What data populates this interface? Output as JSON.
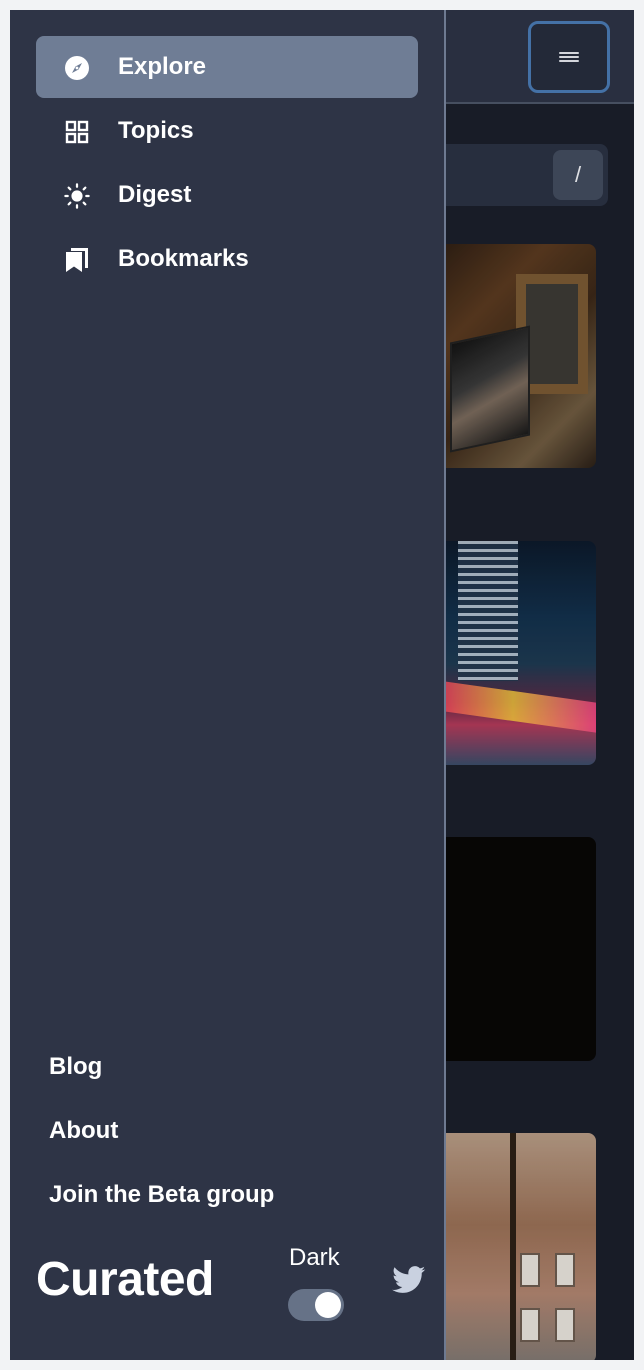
{
  "header": {
    "menu_button_label": "menu"
  },
  "search": {
    "shortcut_key": "/"
  },
  "drawer": {
    "nav_items": [
      {
        "label": "Explore",
        "icon": "compass-icon",
        "active": true
      },
      {
        "label": "Topics",
        "icon": "grid-icon",
        "active": false
      },
      {
        "label": "Digest",
        "icon": "sun-icon",
        "active": false
      },
      {
        "label": "Bookmarks",
        "icon": "bookmarks-icon",
        "active": false
      }
    ],
    "footer_links": [
      {
        "label": "Blog"
      },
      {
        "label": "About"
      },
      {
        "label": "Join the Beta group"
      }
    ],
    "brand": "Curated",
    "theme": {
      "label": "Dark",
      "enabled": true
    },
    "social": {
      "icon": "twitter-icon"
    }
  },
  "feed": {
    "cards": [
      {
        "image": "laptop-on-table-photo"
      },
      {
        "image": "city-night-light-trails-photo"
      },
      {
        "image": "dark-photo"
      },
      {
        "image": "brick-building-tree-photo"
      }
    ]
  },
  "colors": {
    "drawer_bg": "#2e3446",
    "active_item_bg": "#6f7d95",
    "page_bg": "#1b1f2b",
    "menu_button_border": "#4a7bb5",
    "text": "#ffffff"
  }
}
